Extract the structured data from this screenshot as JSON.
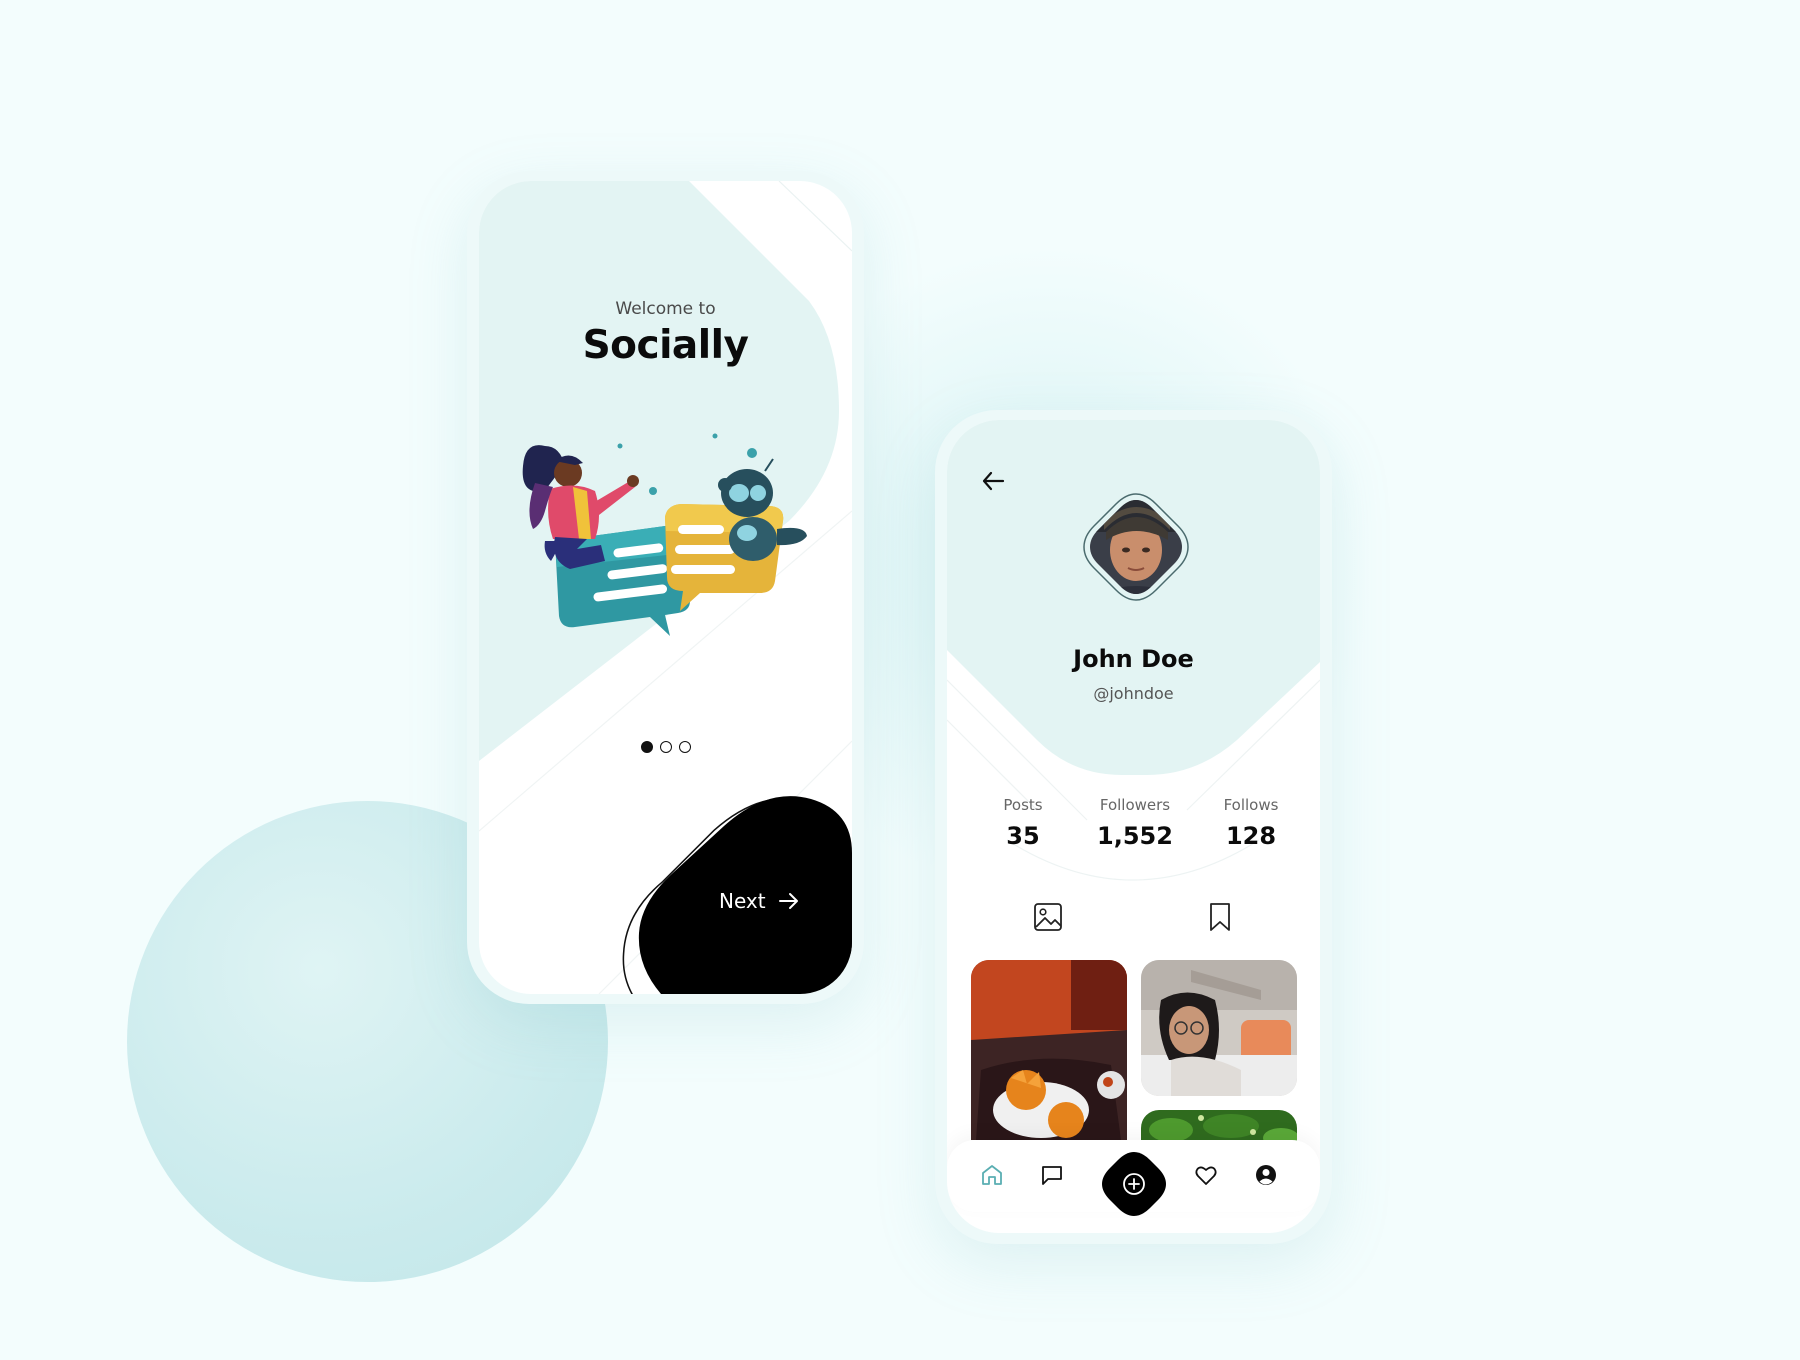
{
  "colors": {
    "page_bg": "#f3fdfd",
    "mint": "#e3f4f3",
    "accent": "#5aaeb2",
    "dark": "#0b0b0b",
    "white": "#ffffff"
  },
  "onboarding": {
    "subtitle": "Welcome to",
    "title": "Socially",
    "pager": {
      "total": 3,
      "active_index": 0
    },
    "next_label": "Next",
    "next_icon": "arrow-right-icon",
    "illustration": "chat-bubbles-illustration"
  },
  "profile": {
    "back_icon": "arrow-left-icon",
    "avatar": "profile-avatar",
    "name": "John Doe",
    "handle": "@johndoe",
    "stats": [
      {
        "label": "Posts",
        "value": "35"
      },
      {
        "label": "Followers",
        "value": "1,552"
      },
      {
        "label": "Follows",
        "value": "128"
      }
    ],
    "tabs": [
      {
        "icon": "image-icon",
        "active": true
      },
      {
        "icon": "bookmark-icon",
        "active": false
      }
    ],
    "photos": [
      "photo-food",
      "photo-girl",
      "photo-leaves"
    ],
    "bottom_nav": [
      {
        "icon": "home-icon",
        "active": true
      },
      {
        "icon": "chat-icon",
        "active": false
      },
      {
        "icon": "add-circle-icon",
        "active": false
      },
      {
        "icon": "heart-icon",
        "active": false
      },
      {
        "icon": "user-icon",
        "active": false
      }
    ]
  }
}
